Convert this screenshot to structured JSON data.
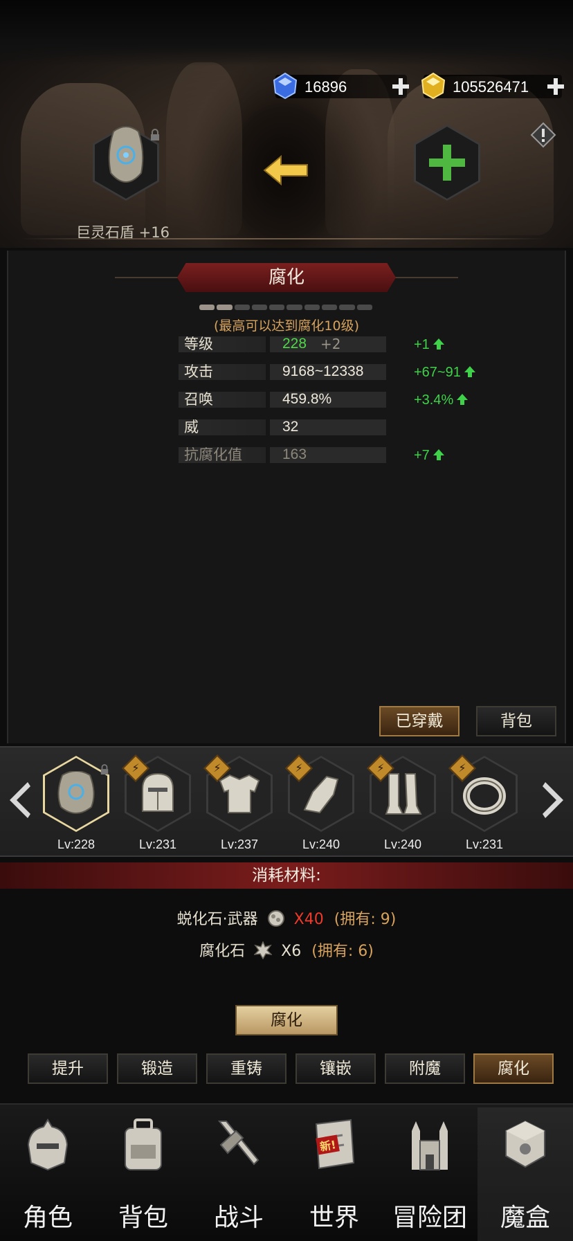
{
  "currency": {
    "gems": "16896",
    "gold": "105526471"
  },
  "item": {
    "name": "巨灵石盾 +16"
  },
  "panel": {
    "title": "腐化",
    "progress": {
      "current": 2,
      "total": 10
    },
    "max_note": "(最高可以达到腐化10级)",
    "stats": [
      {
        "label": "等级",
        "value": "228",
        "bonus": "+2",
        "gain": "+1"
      },
      {
        "label": "攻击",
        "value": "9168~12338",
        "bonus": "",
        "gain": "+67~91"
      },
      {
        "label": "召唤",
        "value": "459.8%",
        "bonus": "",
        "gain": "+3.4%"
      },
      {
        "label": "威",
        "value": "32",
        "bonus": "",
        "gain": ""
      },
      {
        "label": "抗腐化值",
        "value": "163",
        "bonus": "",
        "gain": "+7"
      }
    ],
    "equipped_button": "已穿戴",
    "bag_button": "背包"
  },
  "equipment": [
    {
      "level": "Lv:228",
      "badge": "",
      "icon": "stone-shield-icon"
    },
    {
      "level": "Lv:231",
      "badge": "⚡",
      "icon": "helmet-icon"
    },
    {
      "level": "Lv:237",
      "badge": "⚡",
      "icon": "armor-icon"
    },
    {
      "level": "Lv:240",
      "badge": "⚡",
      "icon": "gauntlet-icon"
    },
    {
      "level": "Lv:240",
      "badge": "⚡",
      "icon": "greaves-icon"
    },
    {
      "level": "Lv:231",
      "badge": "⚡",
      "icon": "ring-icon"
    }
  ],
  "materials": {
    "header": "消耗材料:",
    "items": [
      {
        "name": "蜕化石·武器",
        "qty": "X40",
        "own": "(拥有: 9)",
        "insufficient": true
      },
      {
        "name": "腐化石",
        "qty": "X6",
        "own": "(拥有: 6)",
        "insufficient": false
      }
    ]
  },
  "action_button": "腐化",
  "tabs": [
    {
      "label": "提升",
      "active": false
    },
    {
      "label": "锻造",
      "active": false
    },
    {
      "label": "重铸",
      "active": false
    },
    {
      "label": "镶嵌",
      "active": false
    },
    {
      "label": "附魔",
      "active": false
    },
    {
      "label": "腐化",
      "active": true
    }
  ],
  "nav": [
    {
      "label": "角色",
      "icon": "knight-helmet-icon"
    },
    {
      "label": "背包",
      "icon": "backpack-icon"
    },
    {
      "label": "战斗",
      "icon": "crossed-swords-icon"
    },
    {
      "label": "世界",
      "icon": "scroll-map-icon",
      "tag": "新!"
    },
    {
      "label": "冒险团",
      "icon": "castle-icon"
    },
    {
      "label": "魔盒",
      "icon": "magic-cube-icon",
      "active": true
    }
  ],
  "colors": {
    "gain_green": "#3fd14a",
    "warning_red": "#ee3a2a",
    "own_orange": "#d8a35c",
    "banner_red": "#7a1f1f"
  }
}
